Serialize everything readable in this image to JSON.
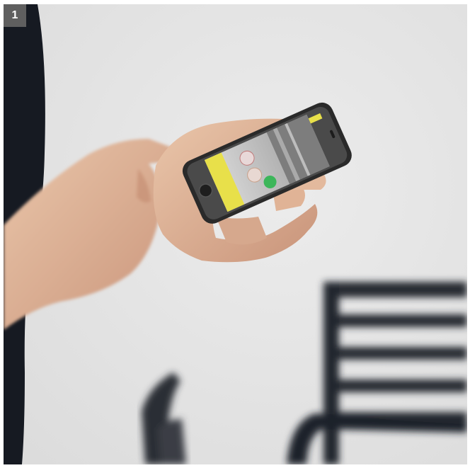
{
  "figure": {
    "number_label": "1"
  },
  "colors": {
    "wall": "#e4e4e4",
    "shirt": "#161a22",
    "skin": "#e2b799",
    "phone_body": "#2a2a2a",
    "app_accent_yellow": "#e8e04a",
    "app_green": "#3cb65a",
    "chair": "#262a32",
    "badge": "#5f5f5f"
  },
  "icons": [
    "smartphone",
    "chair"
  ]
}
